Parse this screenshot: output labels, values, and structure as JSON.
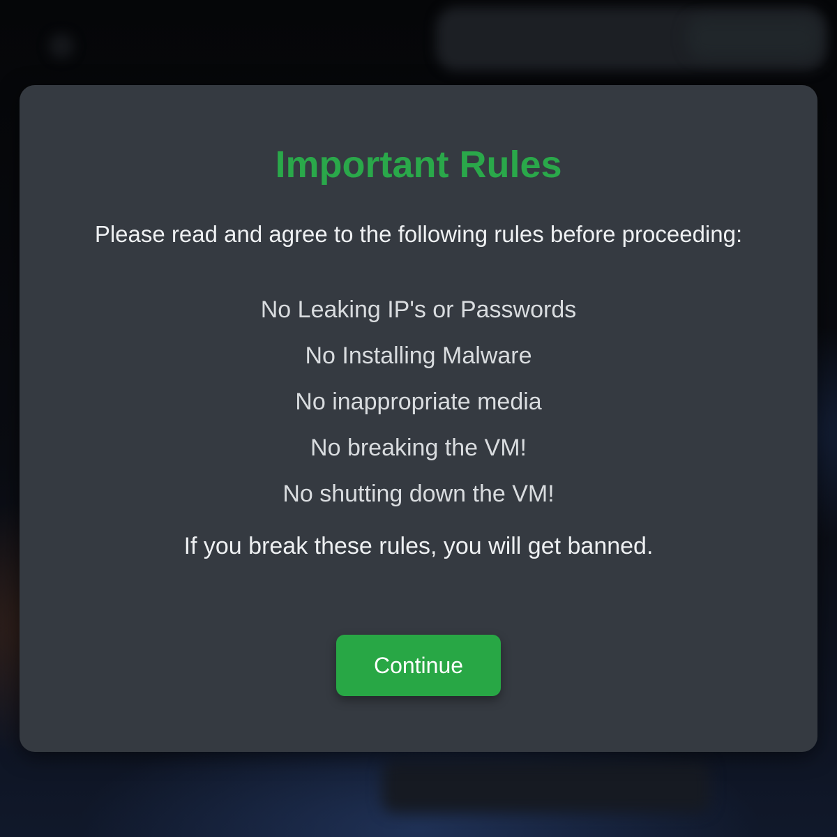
{
  "modal": {
    "title": "Important Rules",
    "intro": "Please read and agree to the following rules before proceeding:",
    "rules": [
      "No Leaking IP's or Passwords",
      "No Installing Malware",
      "No inappropriate media",
      "No breaking the VM!",
      "No shutting down the VM!"
    ],
    "warning": "If you break these rules, you will get banned.",
    "continue_label": "Continue"
  },
  "colors": {
    "accent": "#28a745",
    "title": "#2aa84a",
    "modal_background": "#353a41"
  }
}
